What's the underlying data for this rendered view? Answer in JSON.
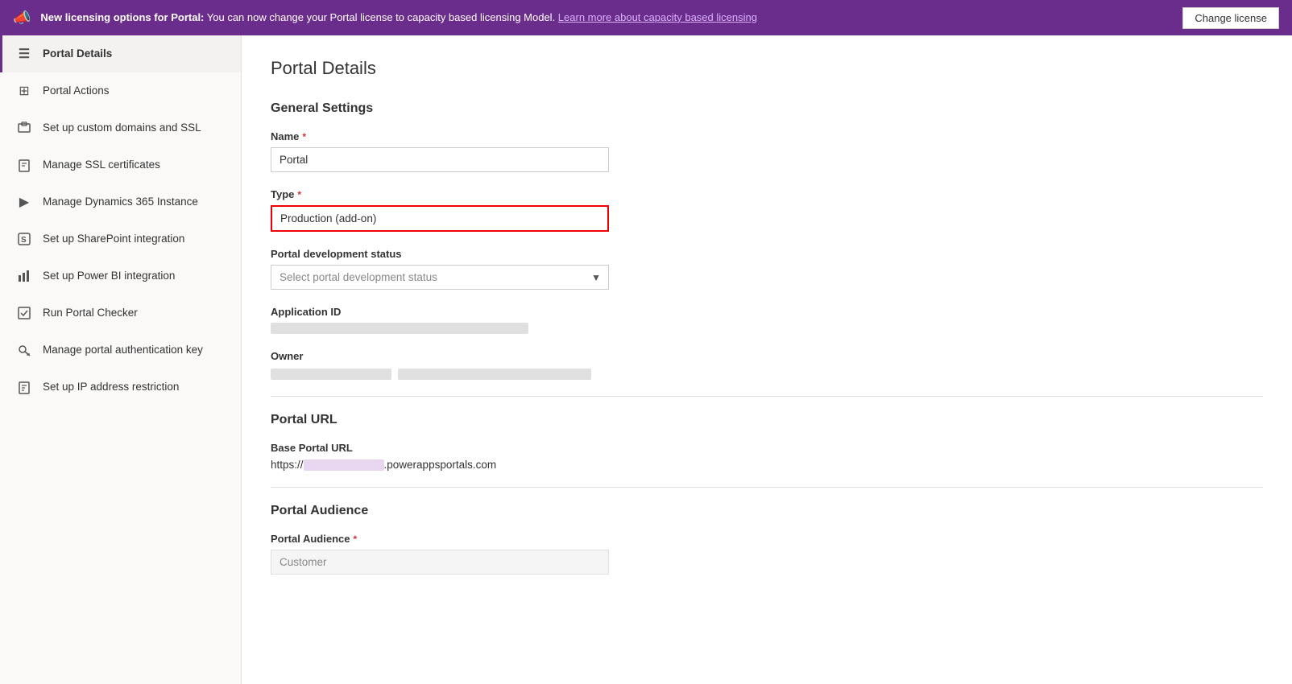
{
  "banner": {
    "icon": "📣",
    "text_prefix": "New licensing options for Portal:",
    "text_body": " You can now change your Portal license to capacity based licensing Model. ",
    "link_text": "Learn more about capacity based licensing",
    "button_label": "Change license"
  },
  "sidebar": {
    "items": [
      {
        "id": "portal-details",
        "label": "Portal Details",
        "icon": "☰",
        "active": true
      },
      {
        "id": "portal-actions",
        "label": "Portal Actions",
        "icon": "⊞",
        "active": false
      },
      {
        "id": "custom-domains",
        "label": "Set up custom domains and SSL",
        "icon": "🖥",
        "active": false
      },
      {
        "id": "ssl-certificates",
        "label": "Manage SSL certificates",
        "icon": "📄",
        "active": false
      },
      {
        "id": "dynamics-instance",
        "label": "Manage Dynamics 365 Instance",
        "icon": "▶",
        "active": false
      },
      {
        "id": "sharepoint",
        "label": "Set up SharePoint integration",
        "icon": "S",
        "active": false
      },
      {
        "id": "power-bi",
        "label": "Set up Power BI integration",
        "icon": "📊",
        "active": false
      },
      {
        "id": "portal-checker",
        "label": "Run Portal Checker",
        "icon": "🔲",
        "active": false
      },
      {
        "id": "auth-key",
        "label": "Manage portal authentication key",
        "icon": "🔒",
        "active": false
      },
      {
        "id": "ip-restriction",
        "label": "Set up IP address restriction",
        "icon": "📋",
        "active": false
      }
    ]
  },
  "content": {
    "page_title": "Portal Details",
    "sections": {
      "general_settings": {
        "title": "General Settings",
        "name_label": "Name",
        "name_value": "Portal",
        "name_placeholder": "Portal",
        "type_label": "Type",
        "type_value": "Production (add-on)",
        "type_placeholder": "Production (add-on)",
        "dev_status_label": "Portal development status",
        "dev_status_placeholder": "Select portal development status",
        "app_id_label": "Application ID",
        "owner_label": "Owner"
      },
      "portal_url": {
        "title": "Portal URL",
        "base_url_label": "Base Portal URL",
        "base_url_prefix": "https://",
        "base_url_suffix": ".powerappsportals.com"
      },
      "portal_audience": {
        "title": "Portal Audience",
        "label": "Portal Audience",
        "value": "Customer",
        "placeholder": "Customer"
      }
    }
  }
}
